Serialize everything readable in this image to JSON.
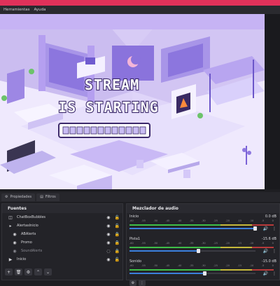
{
  "menu": {
    "items": [
      "Herramientas",
      "Ayuda"
    ]
  },
  "scene": {
    "line1": "STREAM",
    "line2": "IS STARTING",
    "loading_segments": 12
  },
  "tabs": [
    {
      "label": "Propiedades"
    },
    {
      "label": "Filtros"
    }
  ],
  "sources": {
    "title": "Fuentes",
    "items": [
      {
        "label": "ChatBoxBubbles",
        "icon": "group-icon",
        "visible": true,
        "locked": false
      },
      {
        "label": "AlertasInicio",
        "icon": "folder-icon",
        "visible": true,
        "locked": false
      },
      {
        "label": "ABAlerts",
        "icon": "browser-icon",
        "visible": true,
        "locked": true
      },
      {
        "label": "Promo",
        "icon": "browser-icon",
        "visible": true,
        "locked": true
      },
      {
        "label": "SoundAlerts",
        "icon": "browser-icon",
        "visible": false,
        "locked": true
      },
      {
        "label": "Inicio",
        "icon": "play-icon",
        "visible": true,
        "locked": false
      }
    ]
  },
  "mixer": {
    "title": "Mezclador de audio",
    "scale": [
      "-60",
      "-55",
      "-50",
      "-45",
      "-40",
      "-35",
      "-30",
      "-25",
      "-20",
      "-15",
      "-10",
      "-5",
      "0"
    ],
    "channels": [
      {
        "name": "Inicio",
        "db": "0.0 dB",
        "level": 1.0
      },
      {
        "name": "Pista1",
        "db": "-15.6 dB",
        "level": 0.55
      },
      {
        "name": "Sonido",
        "db": "-15.0 dB",
        "level": 0.6
      }
    ]
  },
  "colors": {
    "titlebar": "#e0315a",
    "accent": "#3b7fdc",
    "scene_bg": "#e9e2fb",
    "text_stroke": "#3c2a6b"
  }
}
